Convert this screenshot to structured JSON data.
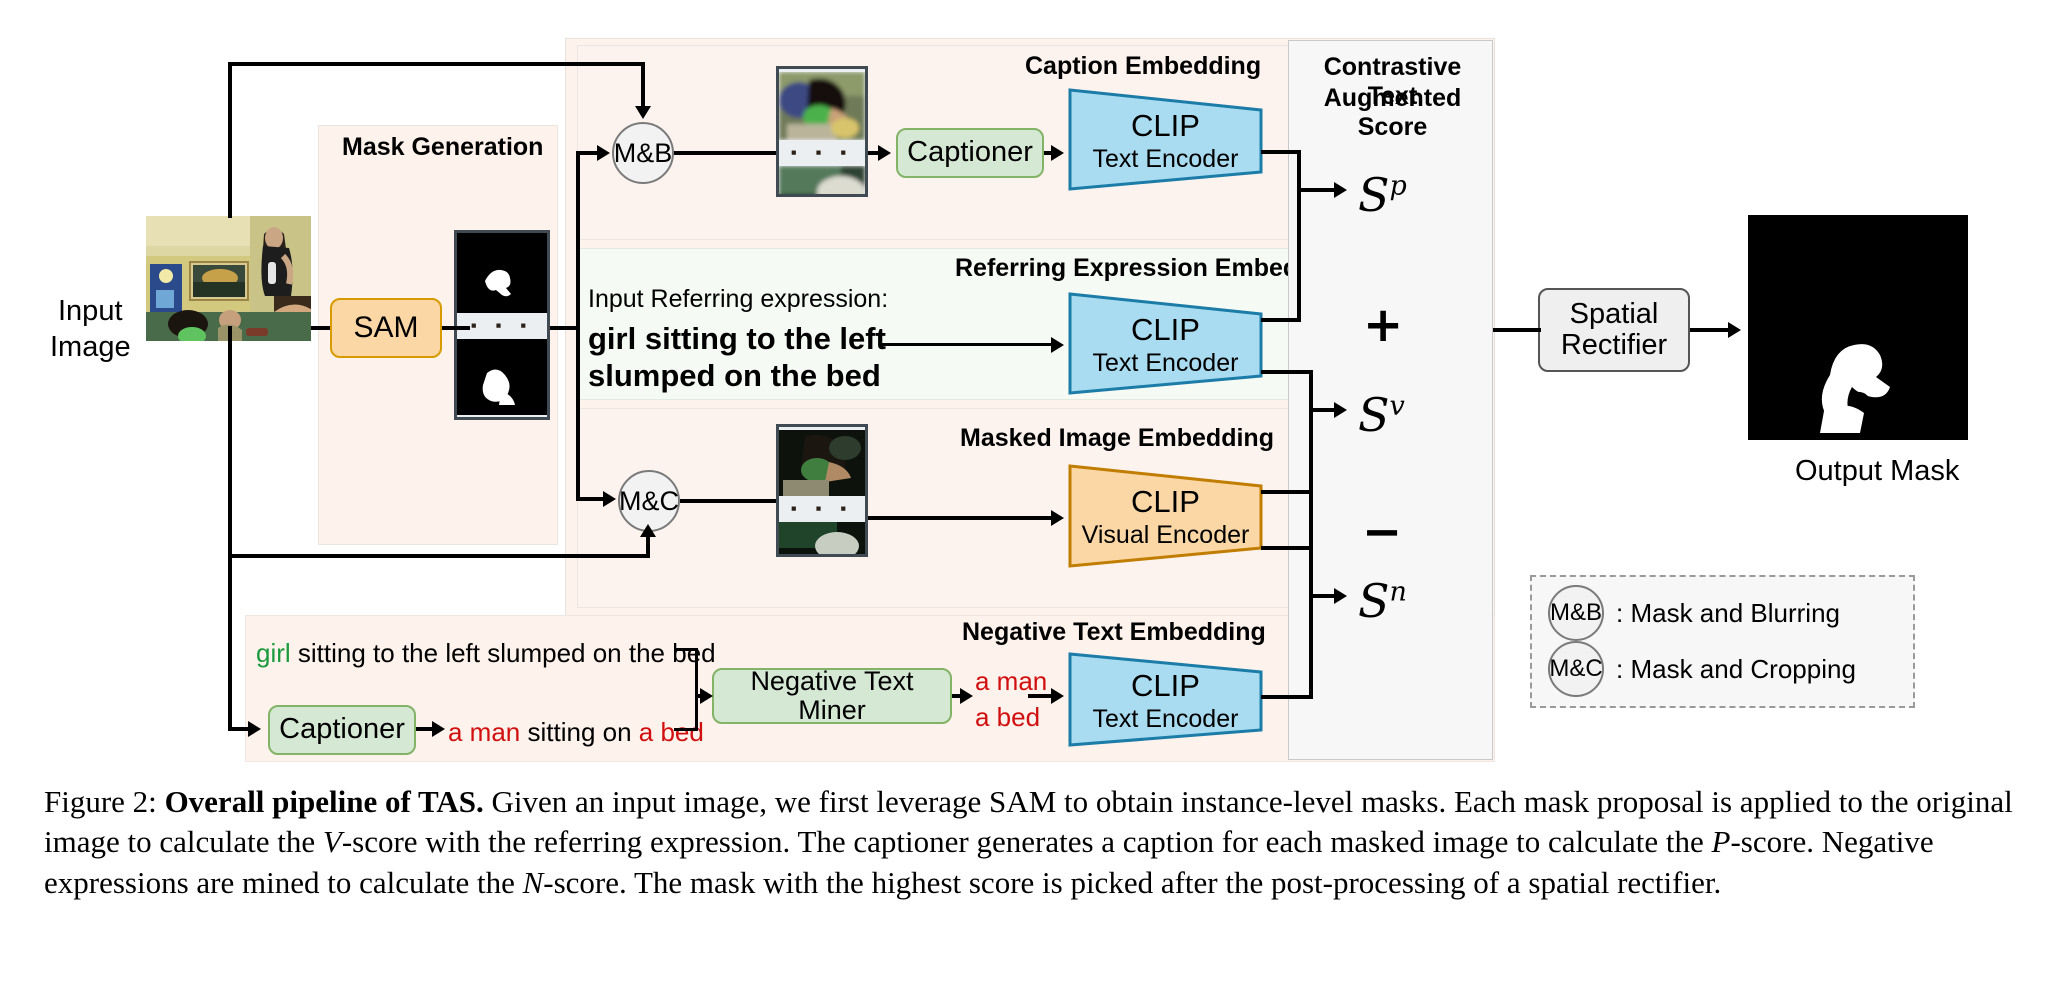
{
  "figure": {
    "input_label_line1": "Input",
    "input_label_line2": "Image",
    "output_label": "Output Mask"
  },
  "mask_generation": {
    "title": "Mask Generation",
    "sam_label": "SAM",
    "dots": "▪ ▪ ▪"
  },
  "caption_embedding": {
    "title": "Caption Embedding",
    "mb_circle": "M&B",
    "captioner_label": "Captioner",
    "encoder_title": "CLIP",
    "encoder_subtitle": "Text Encoder",
    "dots": "▪ ▪ ▪"
  },
  "referring_embedding": {
    "title": "Referring Expression Embedding",
    "prompt_label": "Input Referring expression:",
    "expression_line1": "girl sitting to the left",
    "expression_line2": "slumped on the bed",
    "encoder_title": "CLIP",
    "encoder_subtitle": "Text Encoder"
  },
  "masked_image_embedding": {
    "title": "Masked Image Embedding",
    "mc_circle": "M&C",
    "encoder_title": "CLIP",
    "encoder_subtitle": "Visual Encoder",
    "dots": "▪ ▪ ▪"
  },
  "negative_embedding": {
    "title": "Negative Text Embedding",
    "ref_sentence_highlight": "girl",
    "ref_sentence_rest": " sitting to the left slumped on the bed",
    "captioner_label": "Captioner",
    "caption_part1": "a man",
    "caption_part2": " sitting on ",
    "caption_part3": "a bed",
    "miner_label": "Negative Text Miner",
    "neg_text_1": "a man",
    "neg_text_2": "a bed",
    "encoder_title": "CLIP",
    "encoder_subtitle": "Text Encoder"
  },
  "score_panel": {
    "title_line1": "Contrastive Text",
    "title_line2": "Augmented Score",
    "score_p": "S",
    "score_p_sup": "p",
    "score_v": "S",
    "score_v_sup": "v",
    "score_n": "S",
    "score_n_sup": "n",
    "op_plus": "+",
    "op_minus": "−"
  },
  "rectifier": {
    "line1": "Spatial",
    "line2": "Rectifier"
  },
  "legend": {
    "rows": [
      {
        "circle": "M&B",
        "label": ": Mask and Blurring"
      },
      {
        "circle": "M&C",
        "label": ": Mask and Cropping"
      }
    ]
  },
  "figure_caption": {
    "prefix": "Figure 2: ",
    "bold": "Overall pipeline of TAS.",
    "text_1": " Given an input image, we first leverage SAM to obtain instance-level masks. Each mask proposal is applied to the original image to calculate the ",
    "italic_v": "V",
    "text_2": "-score with the referring expression. The captioner generates a caption for each masked image to calculate the ",
    "italic_p": "P",
    "text_3": "-score. Negative expressions are mined to calculate the ",
    "italic_n": "N",
    "text_4": "-score. The mask with the highest score is picked after the post-processing of a spatial rectifier."
  },
  "colors": {
    "green_fill": "#d5e8d4",
    "green_stroke": "#82b366",
    "orange_fill": "#fbd7a5",
    "orange_stroke": "#d79b00",
    "blue_fill": "#a9dcf0",
    "blue_stroke": "#1c7ca8",
    "peach_bg": "#fdf2ec",
    "mint_bg": "#f6faf4",
    "grey_bg": "#f7f7f7",
    "negative_text": "#d10f0f",
    "positive_text": "#1a9a3c"
  }
}
